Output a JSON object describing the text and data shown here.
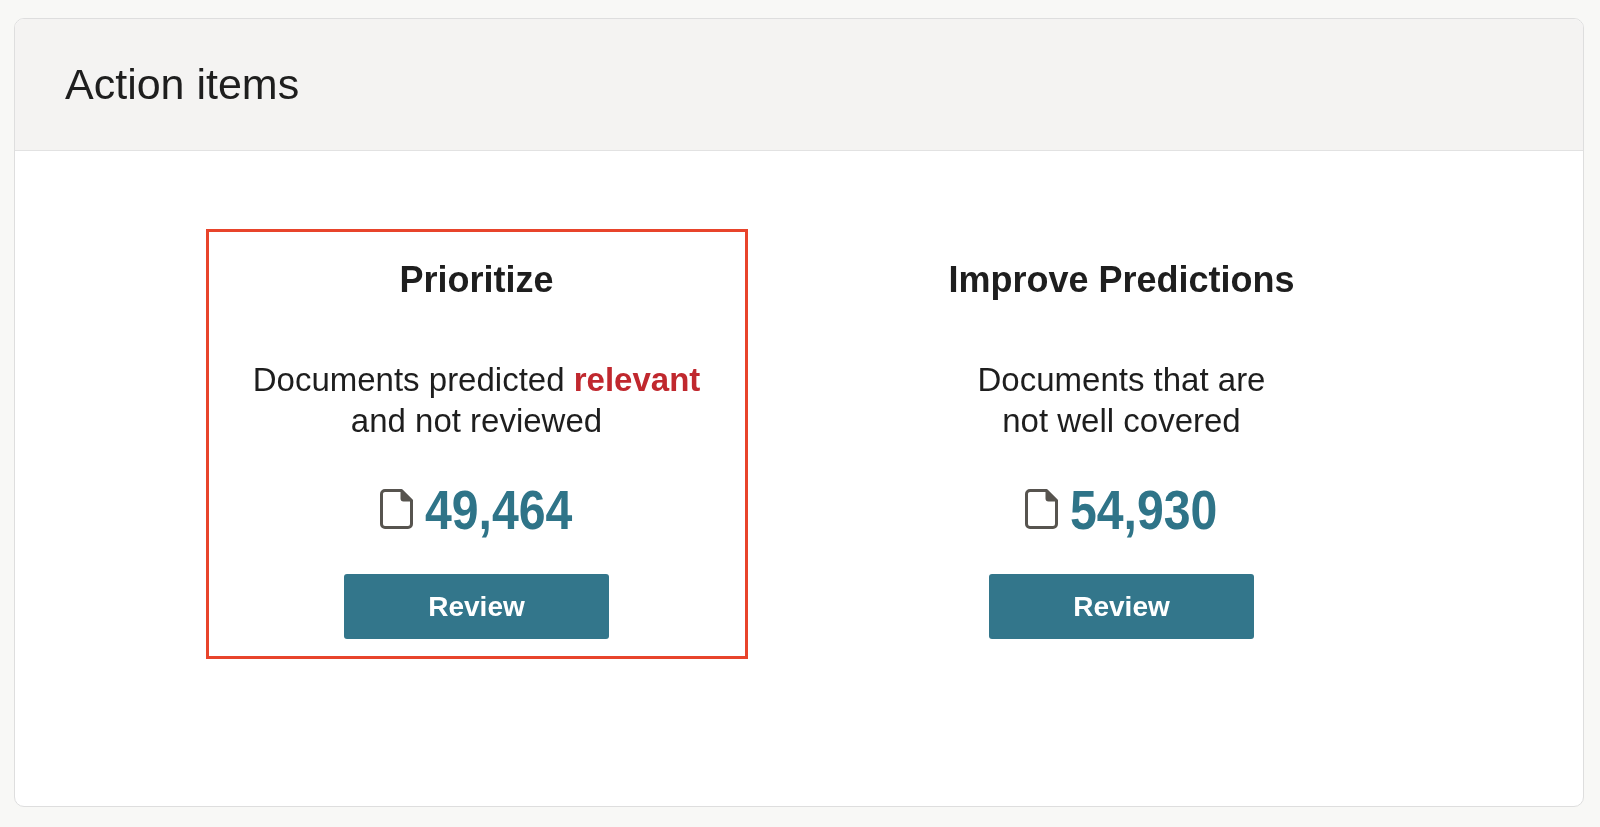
{
  "panel": {
    "title": "Action items"
  },
  "cards": [
    {
      "title": "Prioritize",
      "highlighted": true,
      "description": [
        "Documents predicted **relevant**",
        "and not reviewed"
      ],
      "count": "49,464",
      "button": "Review"
    },
    {
      "title": "Improve Predictions",
      "highlighted": false,
      "description": [
        "Documents that are",
        "not well covered"
      ],
      "count": "54,930",
      "button": "Review"
    }
  ]
}
